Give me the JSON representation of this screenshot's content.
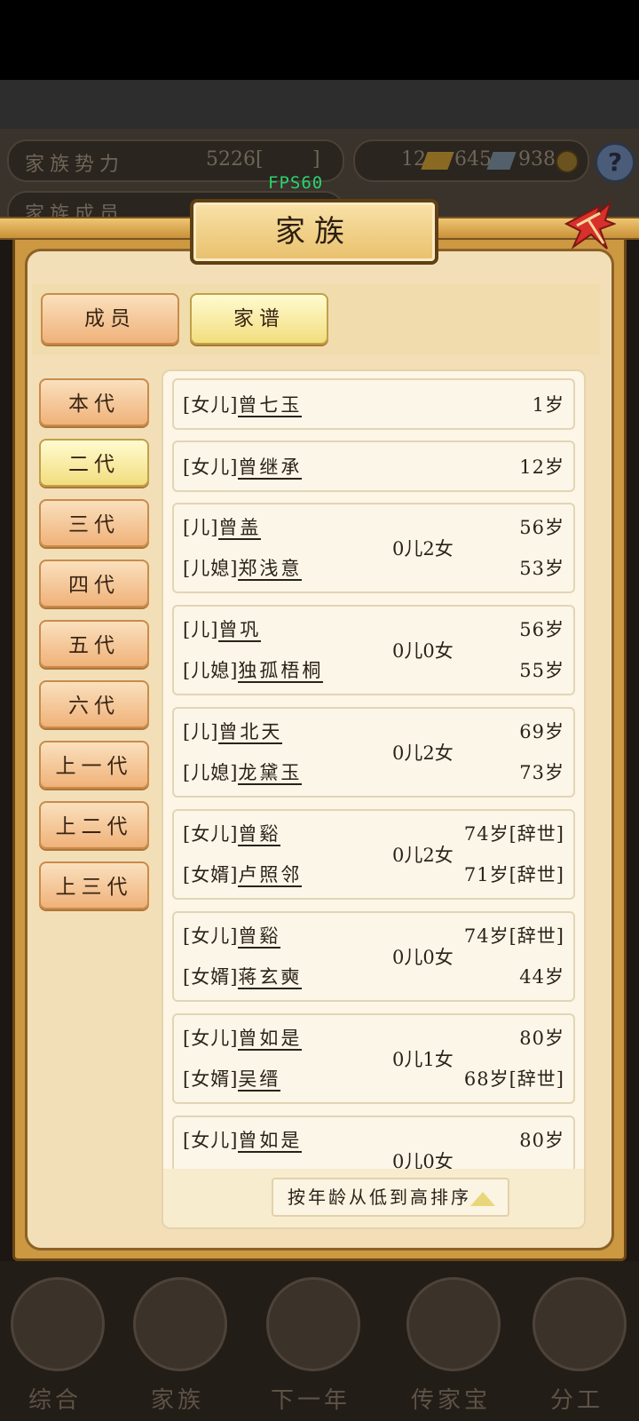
{
  "status_bar": {
    "fps": "FPS60"
  },
  "top_info": {
    "family_power_label": "家族势力",
    "family_power_value": "5226[",
    "family_power_suffix": "]",
    "currency_1": "12",
    "currency_2": "645",
    "currency_3": "938",
    "members_label": "家族成员",
    "help_label": "?"
  },
  "dialog": {
    "title": "家族",
    "tabs": [
      {
        "label": "成员",
        "selected": false
      },
      {
        "label": "家谱",
        "selected": true
      }
    ],
    "generations": [
      {
        "label": "本代",
        "selected": false
      },
      {
        "label": "二代",
        "selected": true
      },
      {
        "label": "三代",
        "selected": false
      },
      {
        "label": "四代",
        "selected": false
      },
      {
        "label": "五代",
        "selected": false
      },
      {
        "label": "六代",
        "selected": false
      },
      {
        "label": "上一代",
        "selected": false
      },
      {
        "label": "上二代",
        "selected": false
      },
      {
        "label": "上三代",
        "selected": false
      }
    ],
    "entries": [
      {
        "role1": "[女儿]",
        "name1": "曾七玉",
        "age1": "1岁"
      },
      {
        "role1": "[女儿]",
        "name1": "曾继承",
        "age1": "12岁"
      },
      {
        "role1": "[儿]",
        "name1": "曾盖",
        "age1": "56岁",
        "role2": "[儿媳]",
        "name2": "郑浅意",
        "age2": "53岁",
        "children": "0儿2女"
      },
      {
        "role1": "[儿]",
        "name1": "曾巩",
        "age1": "56岁",
        "role2": "[儿媳]",
        "name2": "独孤梧桐",
        "age2": "55岁",
        "children": "0儿0女"
      },
      {
        "role1": "[儿]",
        "name1": "曾北天",
        "age1": "69岁",
        "role2": "[儿媳]",
        "name2": "龙黛玉",
        "age2": "73岁",
        "children": "0儿2女"
      },
      {
        "role1": "[女儿]",
        "name1": "曾谿",
        "age1": "74岁[辞世]",
        "role2": "[女婿]",
        "name2": "卢照邻",
        "age2": "71岁[辞世]",
        "children": "0儿2女"
      },
      {
        "role1": "[女儿]",
        "name1": "曾谿",
        "age1": "74岁[辞世]",
        "role2": "[女婿]",
        "name2": "蒋玄奭",
        "age2": "44岁",
        "children": "0儿0女"
      },
      {
        "role1": "[女儿]",
        "name1": "曾如是",
        "age1": "80岁",
        "role2": "[女婿]",
        "name2": "吴缙",
        "age2": "68岁[辞世]",
        "children": "0儿1女"
      },
      {
        "role1": "[女儿]",
        "name1": "曾如是",
        "age1": "80岁",
        "children": "0儿0女"
      }
    ],
    "sort_label": "按年龄从低到高排序"
  },
  "bottom_nav": [
    {
      "label": "综合"
    },
    {
      "label": "家族"
    },
    {
      "label": "下一年"
    },
    {
      "label": "传家宝"
    },
    {
      "label": "分工"
    }
  ]
}
